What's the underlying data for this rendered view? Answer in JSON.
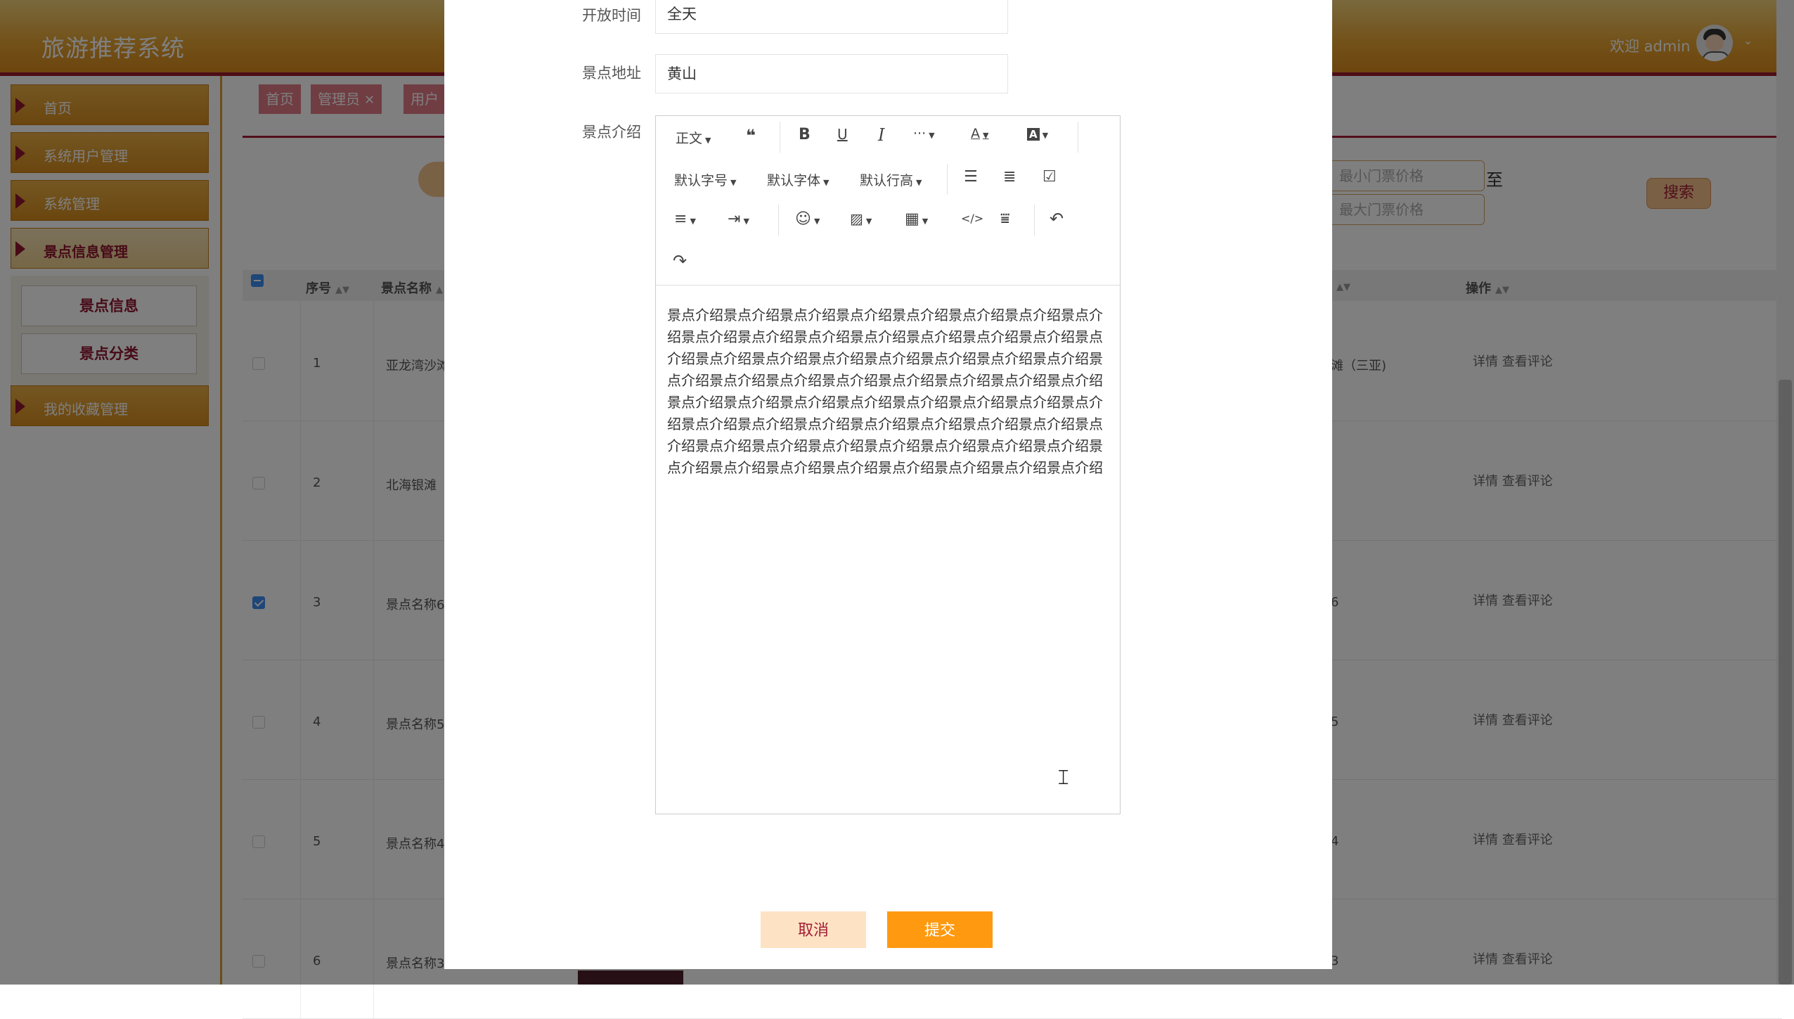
{
  "app": {
    "title": "旅游推荐系统",
    "welcome": "欢迎 admin"
  },
  "sidebar": {
    "items": [
      {
        "label": "首页"
      },
      {
        "label": "系统用户管理"
      },
      {
        "label": "系统管理"
      },
      {
        "label": "景点信息管理"
      },
      {
        "label": "我的收藏管理"
      }
    ],
    "sub_items": [
      {
        "label": "景点信息"
      },
      {
        "label": "景点分类"
      }
    ]
  },
  "tabs": [
    {
      "label": "首页"
    },
    {
      "label": "管理员"
    },
    {
      "label": "用户"
    }
  ],
  "search": {
    "min_price_placeholder": "最小门票价格",
    "max_price_placeholder": "最大门票价格",
    "to_label": "至",
    "button_label": "搜索"
  },
  "table": {
    "headers": {
      "index": "序号",
      "name": "景点名称",
      "ops": "操作"
    },
    "rows": [
      {
        "index": "1",
        "name": "亚龙湾沙滩",
        "right": "滩（三亚)",
        "checked": false
      },
      {
        "index": "2",
        "name": "北海银滩",
        "right": "",
        "checked": false
      },
      {
        "index": "3",
        "name": "景点名称6",
        "right": "6",
        "checked": true
      },
      {
        "index": "4",
        "name": "景点名称5",
        "right": "5",
        "checked": false
      },
      {
        "index": "5",
        "name": "景点名称4",
        "right": "4",
        "checked": false
      },
      {
        "index": "6",
        "name": "景点名称3",
        "right": "3",
        "checked": false
      }
    ],
    "op_detail": "详情",
    "op_comments": "查看评论"
  },
  "dialog": {
    "fields": {
      "open_time_label": "开放时间",
      "open_time_value": "全天",
      "address_label": "景点地址",
      "address_value": "黄山",
      "intro_label": "景点介绍"
    },
    "editor": {
      "toolbar": {
        "paragraph": "正文",
        "font_size": "默认字号",
        "font_family": "默认字体",
        "line_height": "默认行高"
      },
      "content": "景点介绍景点介绍景点介绍景点介绍景点介绍景点介绍景点介绍景点介绍景点介绍景点介绍景点介绍景点介绍景点介绍景点介绍景点介绍景点介绍景点介绍景点介绍景点介绍景点介绍景点介绍景点介绍景点介绍景点介绍景点介绍景点介绍景点介绍景点介绍景点介绍景点介绍景点介绍景点介绍景点介绍景点介绍景点介绍景点介绍景点介绍景点介绍景点介绍景点介绍景点介绍景点介绍景点介绍景点介绍景点介绍景点介绍景点介绍景点介绍景点介绍景点介绍景点介绍景点介绍景点介绍景点介绍景点介绍景点介绍景点介绍景点介绍景点介绍景点介绍景点介绍景点介绍"
    },
    "cancel_label": "取消",
    "submit_label": "提交"
  },
  "colors": {
    "brand_orange": "#ff9910",
    "brand_maroon": "#a31d34",
    "cancel_bg": "#fde2c4"
  }
}
